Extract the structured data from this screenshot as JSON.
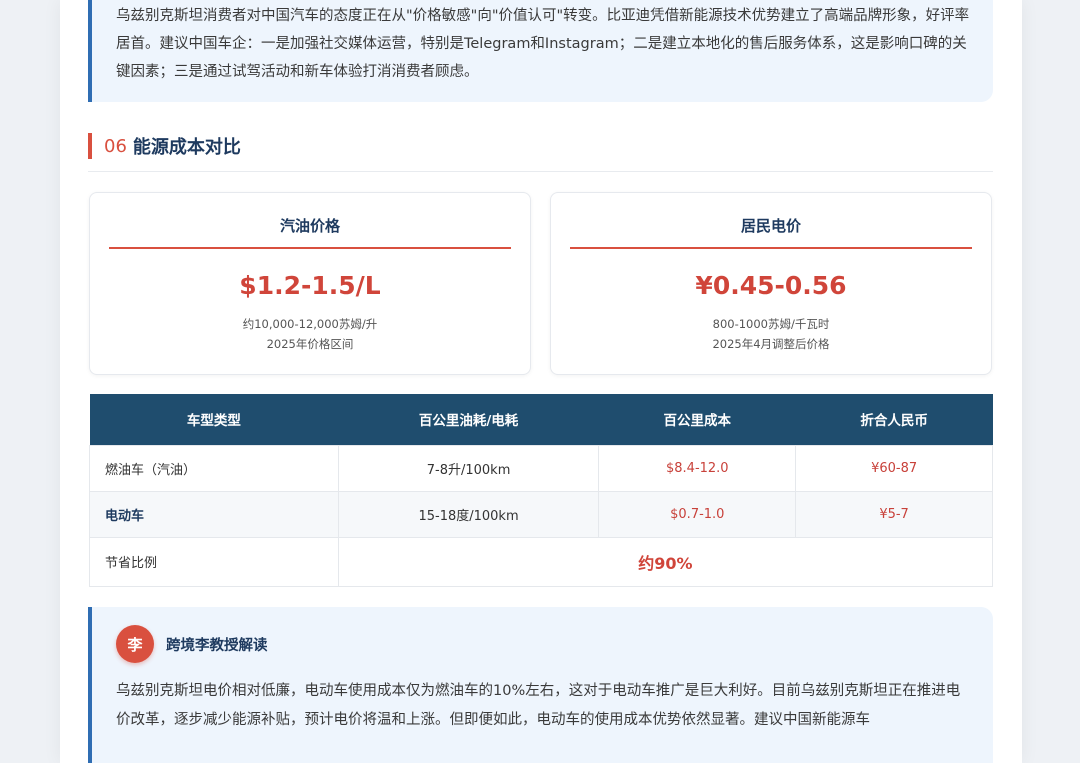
{
  "intro_quote": {
    "text": "乌兹别克斯坦消费者对中国汽车的态度正在从\"价格敏感\"向\"价值认可\"转变。比亚迪凭借新能源技术优势建立了高端品牌形象，好评率居首。建议中国车企：一是加强社交媒体运营，特别是Telegram和Instagram；二是建立本地化的售后服务体系，这是影响口碑的关键因素；三是通过试驾活动和新车体验打消消费者顾虑。"
  },
  "section": {
    "number": "06",
    "title": "能源成本对比"
  },
  "cards": [
    {
      "title": "汽油价格",
      "value": "$1.2-1.5/L",
      "note1": "约10,000-12,000苏姆/升",
      "note2": "2025年价格区间"
    },
    {
      "title": "居民电价",
      "value": "¥0.45-0.56",
      "note1": "800-1000苏姆/千瓦时",
      "note2": "2025年4月调整后价格"
    }
  ],
  "table": {
    "headers": [
      "车型类型",
      "百公里油耗/电耗",
      "百公里成本",
      "折合人民币"
    ],
    "rows": [
      [
        "燃油车（汽油）",
        "7-8升/100km",
        "$8.4-12.0",
        "¥60-87"
      ],
      [
        "电动车",
        "15-18度/100km",
        "$0.7-1.0",
        "¥5-7"
      ]
    ],
    "saving_label": "节省比例",
    "saving_value": "约90%"
  },
  "professor": {
    "avatar_char": "李",
    "name": "跨境李教授解读",
    "text": "乌兹别克斯坦电价相对低廉，电动车使用成本仅为燃油车的10%左右，这对于电动车推广是巨大利好。目前乌兹别克斯坦正在推进电价改革，逐步减少能源补贴，预计电价将温和上涨。但即便如此，电动车的使用成本优势依然显著。建议中国新能源车"
  },
  "colors": {
    "accent_red": "#d9503f",
    "navy": "#1f4d6e",
    "quote_bg": "#eef5fd",
    "quote_border": "#2f6db3"
  }
}
